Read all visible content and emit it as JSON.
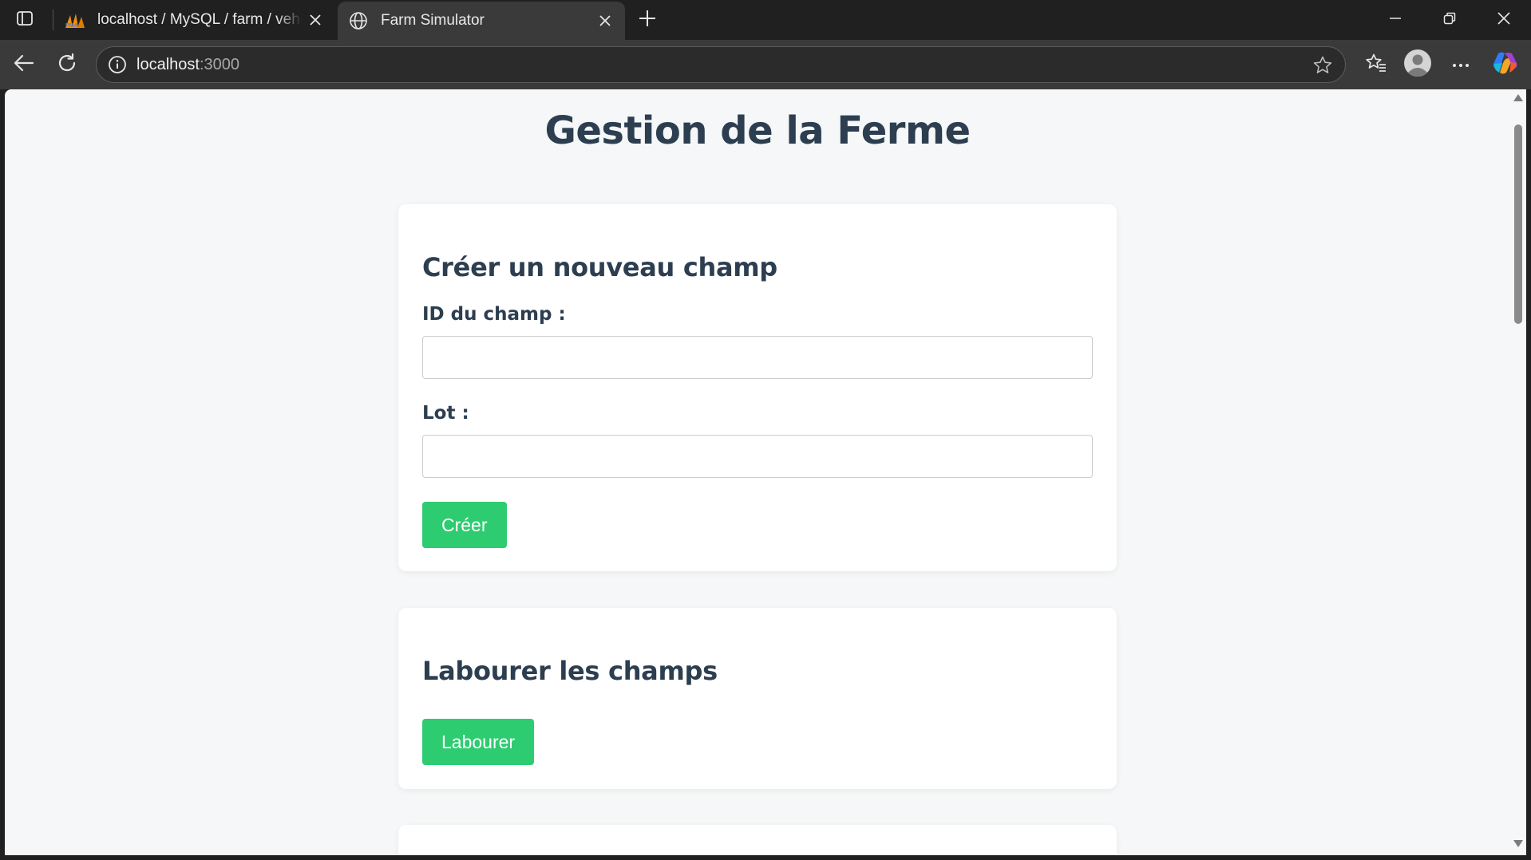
{
  "browser": {
    "tabs": [
      {
        "title": "localhost / MySQL / farm / vehicu",
        "favicon": "phpmyadmin-icon",
        "active": false
      },
      {
        "title": "Farm Simulator",
        "favicon": "globe-icon",
        "active": true
      }
    ],
    "address": {
      "host": "localhost",
      "port": ":3000"
    }
  },
  "page": {
    "title": "Gestion de la Ferme",
    "create_field": {
      "heading": "Créer un nouveau champ",
      "id_label": "ID du champ :",
      "id_value": "",
      "lot_label": "Lot :",
      "lot_value": "",
      "submit_label": "Créer"
    },
    "plow": {
      "heading": "Labourer les champs",
      "button_label": "Labourer"
    }
  },
  "colors": {
    "accent_button": "#2ecc71",
    "heading_text": "#2c3e50",
    "page_background": "#f5f7f8"
  }
}
